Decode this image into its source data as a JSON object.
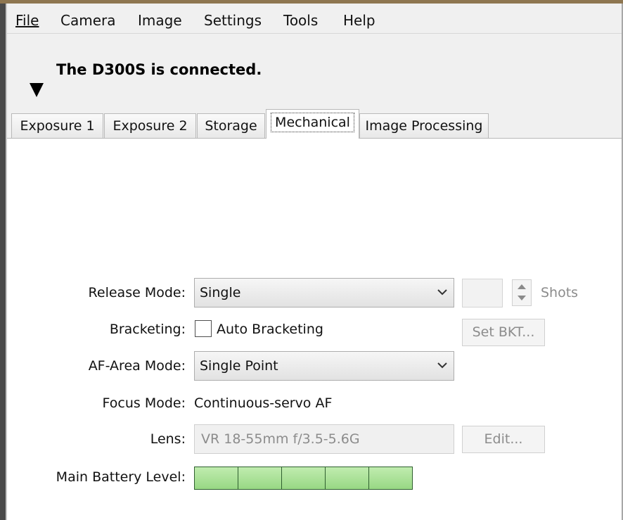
{
  "menu": [
    "File",
    "Camera",
    "Image",
    "Settings",
    "Tools",
    "Help"
  ],
  "status": {
    "message": "The D300S is connected."
  },
  "tabs": [
    "Exposure 1",
    "Exposure 2",
    "Storage",
    "Mechanical",
    "Image Processing"
  ],
  "active_tab": "Mechanical",
  "form": {
    "release_mode": {
      "label": "Release Mode:",
      "value": "Single"
    },
    "shots": {
      "label": "Shots",
      "value": ""
    },
    "bracketing": {
      "label": "Bracketing:",
      "checkbox_label": "Auto Bracketing",
      "checked": false,
      "button": "Set BKT..."
    },
    "af_area_mode": {
      "label": "AF-Area Mode:",
      "value": "Single Point"
    },
    "focus_mode": {
      "label": "Focus Mode:",
      "value": "Continuous-servo AF"
    },
    "lens": {
      "label": "Lens:",
      "value": "VR 18-55mm f/3.5-5.6G",
      "button": "Edit..."
    },
    "battery": {
      "label": "Main Battery Level:",
      "level_fraction": 1.0,
      "segments": 5
    }
  },
  "colors": {
    "battery_fill": "#9edb8c",
    "battery_border": "#2f5f2f",
    "accent_top": "#8e7650"
  }
}
